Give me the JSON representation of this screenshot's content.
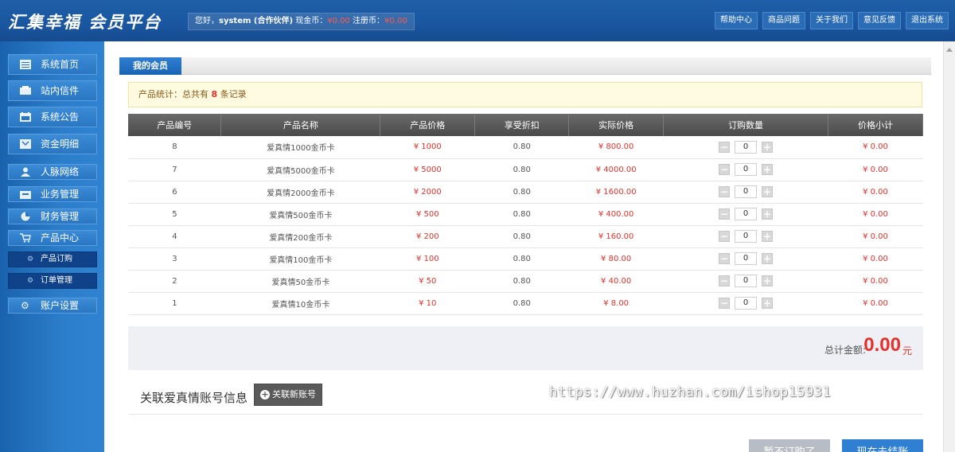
{
  "header": {
    "logo": "汇集幸福 会员平台",
    "welcome_prefix": "您好，",
    "username": "system (合作伙伴)",
    "cash_label": " 现金币：",
    "cash_value": "¥0.00",
    "reg_label": " 注册币：",
    "reg_value": "¥0.00",
    "nav": [
      "帮助中心",
      "商品问题",
      "关于我们",
      "意见反馈",
      "退出系统"
    ]
  },
  "sidebar": {
    "items": [
      "系统首页",
      "站内信件",
      "系统公告",
      "资金明细",
      "人脉网络",
      "业务管理",
      "财务管理",
      "产品中心"
    ],
    "sub_items": [
      "产品订购",
      "订单管理"
    ],
    "account": "账户设置"
  },
  "main": {
    "tab": "我的会员",
    "stat_prefix": "产品统计：总共有 ",
    "stat_count": "8",
    "stat_suffix": " 条记录",
    "columns": [
      "产品编号",
      "产品名称",
      "产品价格",
      "享受折扣",
      "实际价格",
      "订购数量",
      "价格小计"
    ],
    "rows": [
      {
        "id": "8",
        "name": "爱真情1000金币卡",
        "price": "¥ 1000",
        "discount": "0.80",
        "actual": "¥ 800.00",
        "qty": "0",
        "subtotal": "¥ 0.00"
      },
      {
        "id": "7",
        "name": "爱真情5000金币卡",
        "price": "¥ 5000",
        "discount": "0.80",
        "actual": "¥ 4000.00",
        "qty": "0",
        "subtotal": "¥ 0.00"
      },
      {
        "id": "6",
        "name": "爱真情2000金币卡",
        "price": "¥ 2000",
        "discount": "0.80",
        "actual": "¥ 1600.00",
        "qty": "0",
        "subtotal": "¥ 0.00"
      },
      {
        "id": "5",
        "name": "爱真情500金币卡",
        "price": "¥ 500",
        "discount": "0.80",
        "actual": "¥ 400.00",
        "qty": "0",
        "subtotal": "¥ 0.00"
      },
      {
        "id": "4",
        "name": "爱真情200金币卡",
        "price": "¥ 200",
        "discount": "0.80",
        "actual": "¥ 160.00",
        "qty": "0",
        "subtotal": "¥ 0.00"
      },
      {
        "id": "3",
        "name": "爱真情100金币卡",
        "price": "¥ 100",
        "discount": "0.80",
        "actual": "¥ 80.00",
        "qty": "0",
        "subtotal": "¥ 0.00"
      },
      {
        "id": "2",
        "name": "爱真情50金币卡",
        "price": "¥ 50",
        "discount": "0.80",
        "actual": "¥ 40.00",
        "qty": "0",
        "subtotal": "¥ 0.00"
      },
      {
        "id": "1",
        "name": "爱真情10金币卡",
        "price": "¥ 10",
        "discount": "0.80",
        "actual": "¥ 8.00",
        "qty": "0",
        "subtotal": "¥ 0.00"
      }
    ],
    "total_label": "总计金额:",
    "total_value": "0.00",
    "total_unit": "元",
    "assoc_title": "关联爱真情账号信息",
    "assoc_button": "关联新账号",
    "btn_cancel": "暂不订购了",
    "btn_checkout": "现在去结账"
  },
  "watermark": "https://www.huzhan.com/ishop15931",
  "colors": {
    "accent_blue": "#1a63b4",
    "price_red": "#e4312b",
    "header_blue": "#1d5fa8"
  }
}
